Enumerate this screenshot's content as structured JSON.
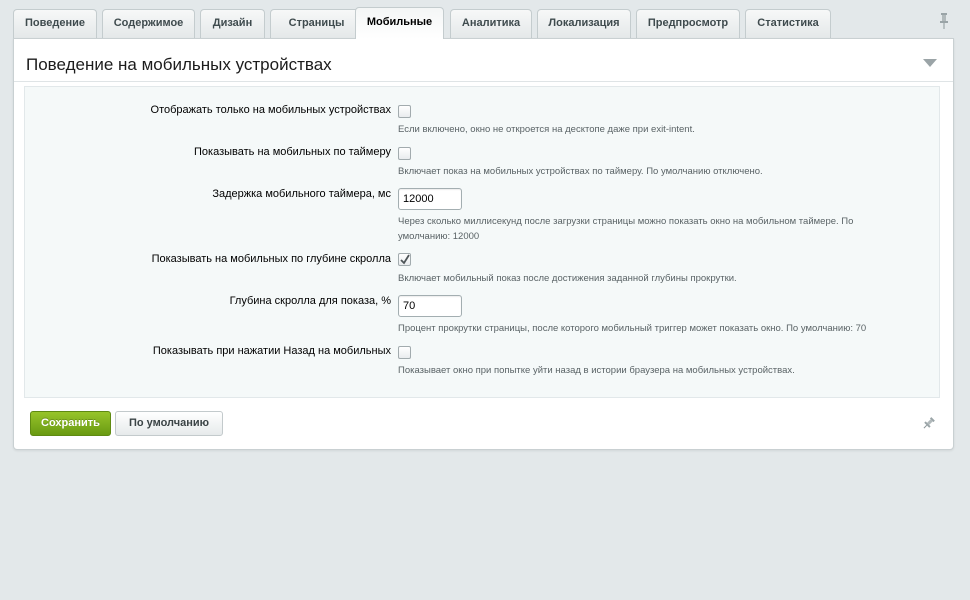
{
  "tabs": [
    {
      "label": "Поведение"
    },
    {
      "label": "Содержимое"
    },
    {
      "label": "Дизайн"
    },
    {
      "label": "Страницы"
    },
    {
      "label": "Мобильные",
      "active": true
    },
    {
      "label": "Аналитика"
    },
    {
      "label": "Локализация"
    },
    {
      "label": "Предпросмотр"
    },
    {
      "label": "Статистика"
    }
  ],
  "panel": {
    "title": "Поведение на мобильных устройствах"
  },
  "fields": {
    "mobile_only": {
      "label": "Отображать только на мобильных устройствах",
      "checked": false,
      "hint": "Если включено, окно не откроется на десктопе даже при exit-intent."
    },
    "timer": {
      "label": "Показывать на мобильных по таймеру",
      "checked": false,
      "hint": "Включает показ на мобильных устройствах по таймеру. По умолчанию отключено."
    },
    "timer_delay": {
      "label": "Задержка мобильного таймера, мс",
      "value": "12000",
      "hint": "Через сколько миллисекунд после загрузки страницы можно показать окно на мобильном таймере. По умолчанию: 12000"
    },
    "scroll": {
      "label": "Показывать на мобильных по глубине скролла",
      "checked": true,
      "hint": "Включает мобильный показ после достижения заданной глубины прокрутки."
    },
    "scroll_depth": {
      "label": "Глубина скролла для показа, %",
      "value": "70",
      "hint": "Процент прокрутки страницы, после которого мобильный триггер может показать окно. По умолчанию: 70"
    },
    "back_button": {
      "label": "Показывать при нажатии Назад на мобильных",
      "checked": false,
      "hint": "Показывает окно при попытке уйти назад в истории браузера на мобильных устройствах."
    }
  },
  "buttons": {
    "save": "Сохранить",
    "default": "По умолчанию"
  },
  "colors": {
    "background": "#e3e8ea",
    "save_button": "#7fae1d",
    "form_box": "#f5f9f9"
  },
  "icons": {
    "top_pin": "pin-icon",
    "collapse": "triangle-down-icon",
    "bottom_pin": "pin-icon"
  }
}
